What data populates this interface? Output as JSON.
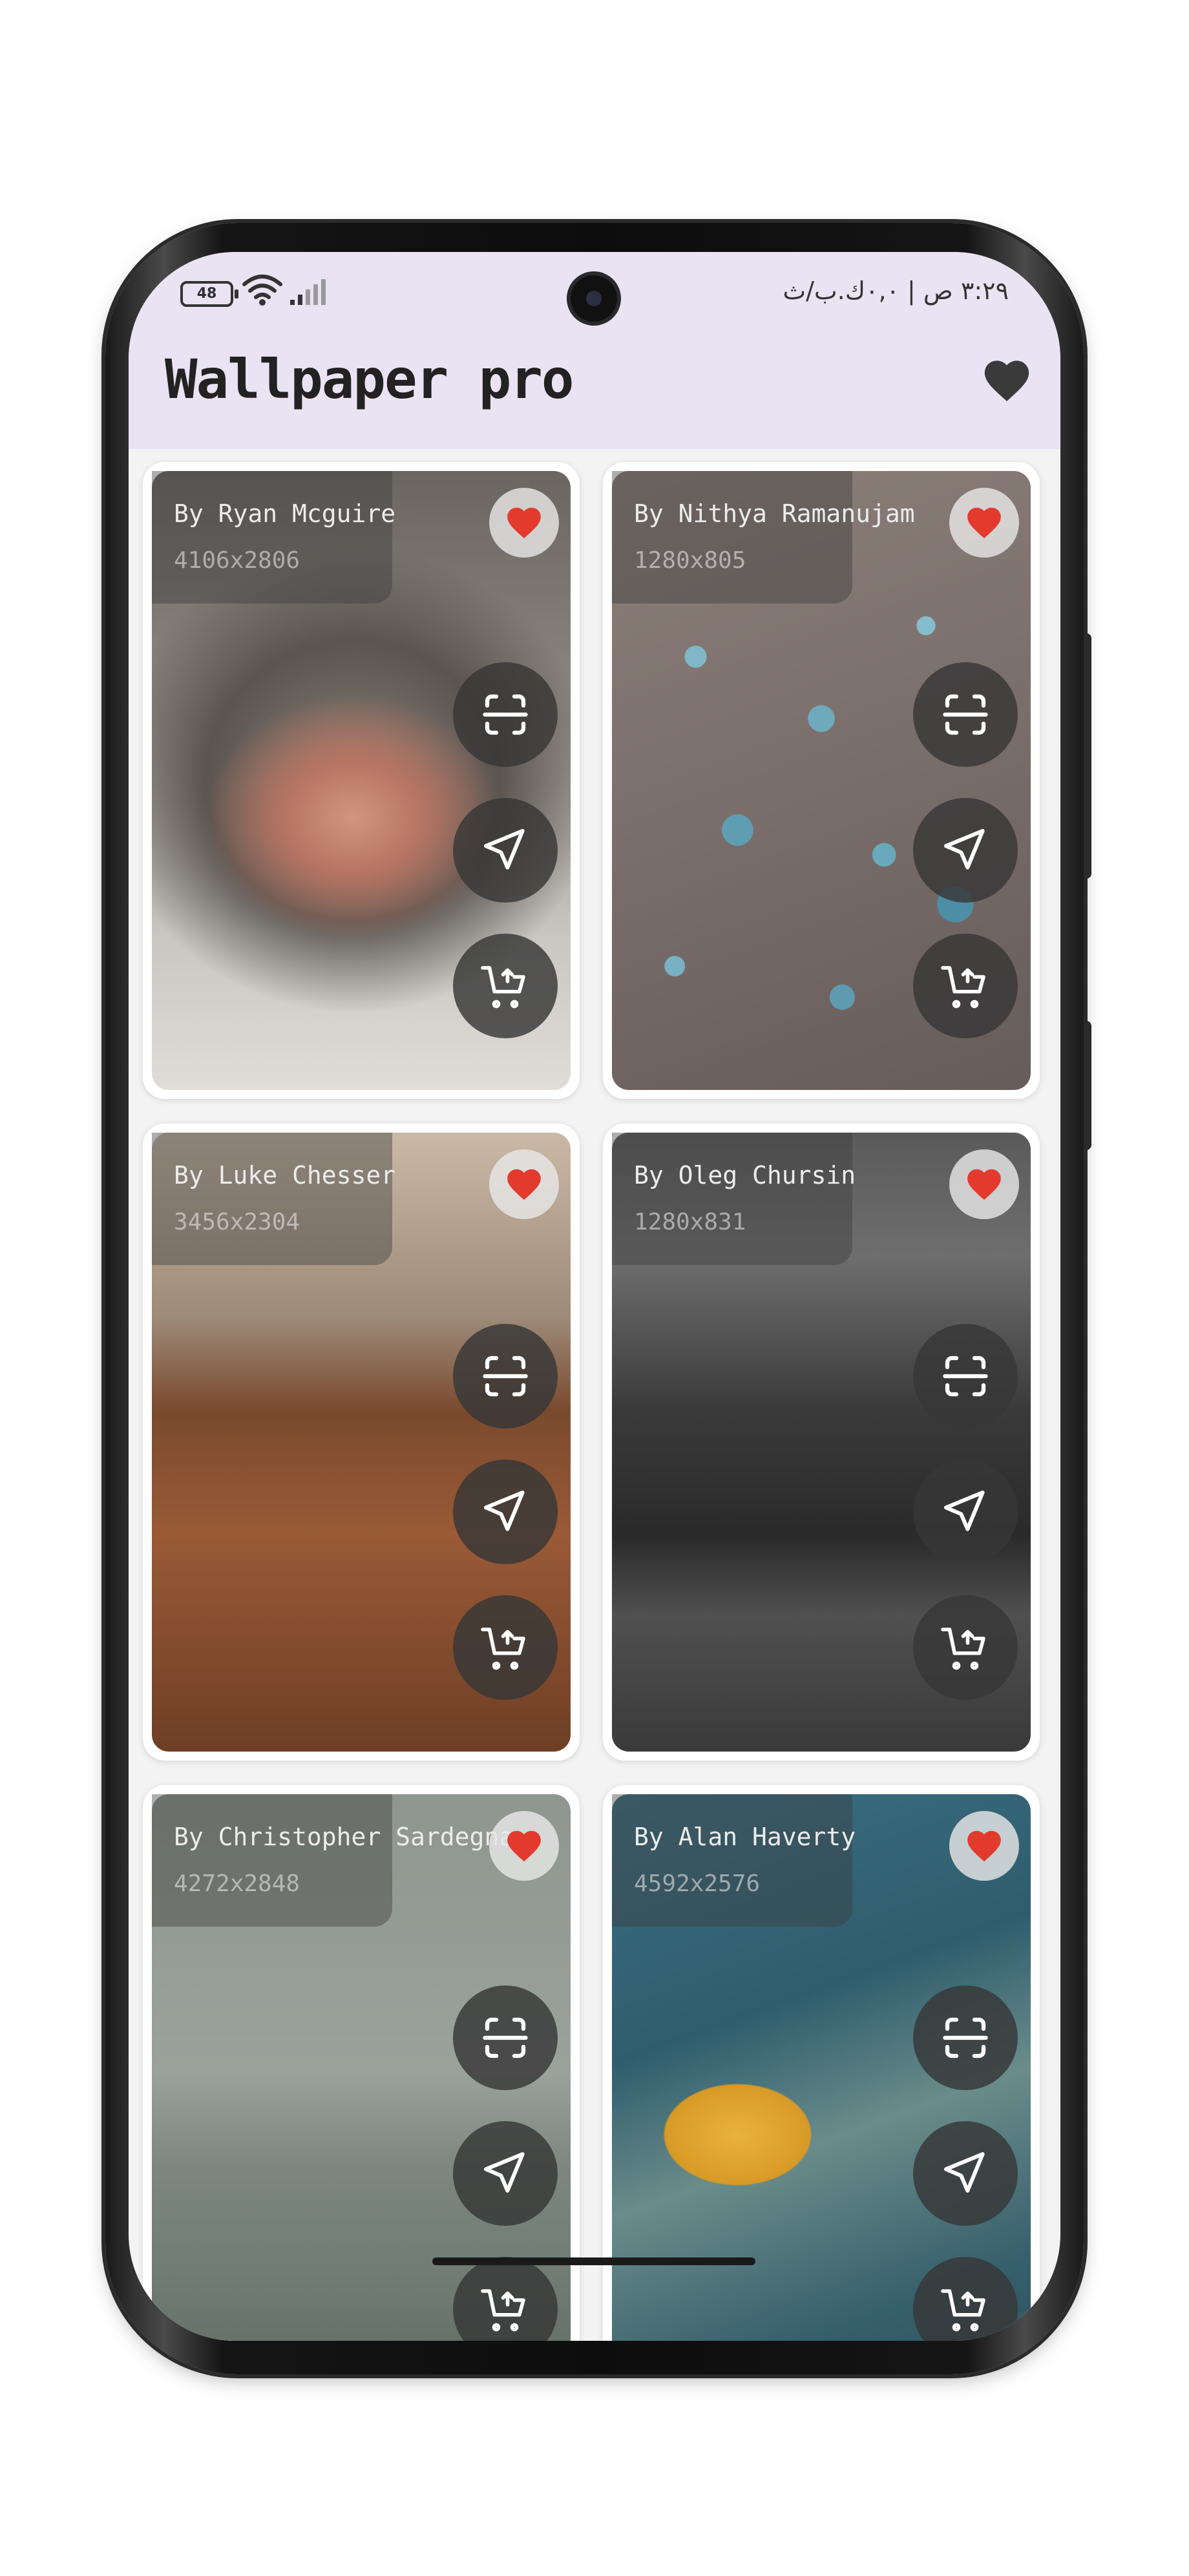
{
  "status_bar": {
    "battery": "48",
    "right_text": "٣:٢٩ ص | ٠,٠ك.ب/ث"
  },
  "app": {
    "title": "Wallpaper pro"
  },
  "colors": {
    "header_bg": "#e9e3f3",
    "heart_red": "#e23b2e",
    "action_bg": "#3a3a3a"
  },
  "cards": [
    {
      "author": "By Ryan Mcguire",
      "dims": "4106x2806",
      "photo": "cat-nose"
    },
    {
      "author": "By Nithya Ramanujam",
      "dims": "1280x805",
      "photo": "water-drops"
    },
    {
      "author": "By Luke Chesser",
      "dims": "3456x2304",
      "photo": "cafe-table"
    },
    {
      "author": "By Oleg Chursin",
      "dims": "1280x831",
      "photo": "city-bridge-night"
    },
    {
      "author": "By Christopher Sardegna",
      "dims": "4272x2848",
      "photo": "foggy-beach"
    },
    {
      "author": "By Alan Haverty",
      "dims": "4592x2576",
      "photo": "tuk-tuk-plate"
    }
  ],
  "card_actions": [
    "set-wallpaper-icon",
    "share-icon",
    "add-to-cart-icon"
  ]
}
